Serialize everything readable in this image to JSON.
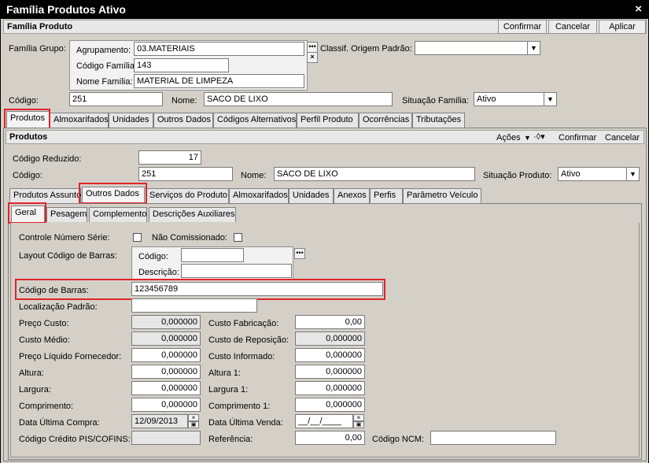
{
  "window": {
    "title": "Família Produtos Ativo",
    "close_glyph": "×"
  },
  "familia": {
    "header": "Família Produto",
    "confirm": "Confirmar",
    "cancel": "Cancelar",
    "apply": "Aplicar",
    "grupo_label": "Família Grupo:",
    "agrupamento_label": "Agrupamento:",
    "agrupamento_value": "03.MATERIAIS",
    "codigo_familia_label": "Código Família:",
    "codigo_familia_value": "143",
    "nome_familia_label": "Nome Família:",
    "nome_familia_value": "MATERIAL DE LIMPEZA",
    "classif_label": "Classif. Origem Padrão:",
    "classif_value": "",
    "codigo_label": "Código:",
    "codigo_value": "251",
    "nome_label": "Nome:",
    "nome_value": "SACO DE LIXO",
    "situacao_label": "Situação Família:",
    "situacao_value": "Ativo"
  },
  "main_tabs": [
    "Produtos",
    "Almoxarifados",
    "Unidades",
    "Outros Dados",
    "Códigos Alternativos",
    "Perfil Produto",
    "Ocorrências",
    "Tributações"
  ],
  "produtos": {
    "header": "Produtos",
    "acoes": "Ações",
    "confirm": "Confirmar",
    "cancel": "Cancelar",
    "codigo_reduzido_label": "Código Reduzido:",
    "codigo_reduzido_value": "17",
    "codigo_label": "Código:",
    "codigo_value": "251",
    "nome_label": "Nome:",
    "nome_value": "SACO DE LIXO",
    "situacao_label": "Situação Produto:",
    "situacao_value": "Ativo"
  },
  "sub_tabs": [
    "Produtos Assunto",
    "Outros Dados",
    "Serviços do Produto",
    "Almoxarifados",
    "Unidades",
    "Anexos",
    "Perfis",
    "Parâmetro Veículo"
  ],
  "inner_tabs": [
    "Geral",
    "Pesagem",
    "Complemento",
    "Descrições Auxiliares"
  ],
  "geral": {
    "controle_serie": "Controle Número Série:",
    "nao_comissionado": "Não Comissionado:",
    "layout_label": "Layout Código de Barras:",
    "layout_codigo_label": "Código:",
    "layout_descricao_label": "Descrição:",
    "codigo_barras_label": "Código de Barras:",
    "codigo_barras_value": "123456789",
    "localizacao_label": "Localização Padrão:",
    "localizacao_value": "",
    "preco_custo_label": "Preço Custo:",
    "preco_custo_value": "0,000000",
    "custo_medio_label": "Custo Médio:",
    "custo_medio_value": "0,000000",
    "preco_liquido_label": "Preço Líquido Fornecedor:",
    "preco_liquido_value": "0,000000",
    "altura_label": "Altura:",
    "altura_value": "0,000000",
    "largura_label": "Largura:",
    "largura_value": "0,000000",
    "comprimento_label": "Comprimento:",
    "comprimento_value": "0,000000",
    "data_compra_label": "Data Última Compra:",
    "data_compra_value": "12/09/2013",
    "credito_label": "Código Crédito PIS/COFINS:",
    "credito_value": "",
    "custo_fabricacao_label": "Custo Fabricação:",
    "custo_fabricacao_value": "0,00",
    "custo_reposicao_label": "Custo de Reposição:",
    "custo_reposicao_value": "0,000000",
    "custo_informado_label": "Custo Informado:",
    "custo_informado_value": "0,000000",
    "altura1_label": "Altura 1:",
    "altura1_value": "0,000000",
    "largura1_label": "Largura 1:",
    "largura1_value": "0,000000",
    "comprimento1_label": "Comprimento 1:",
    "comprimento1_value": "0,000000",
    "data_venda_label": "Data Última Venda:",
    "data_venda_value": "__/__/____",
    "referencia_label": "Referência:",
    "referencia_value": "0,00",
    "ncm_label": "Código NCM:",
    "ncm_value": ""
  },
  "colors": {
    "highlight": "#e0242b",
    "titlebar": "#000000",
    "window": "#d4d0c8"
  },
  "icons": {
    "lookup": "ellipsis-icon",
    "clear": "clear-x-icon",
    "calendar": "calendar-icon",
    "dropdown": "chevron-down-icon"
  }
}
